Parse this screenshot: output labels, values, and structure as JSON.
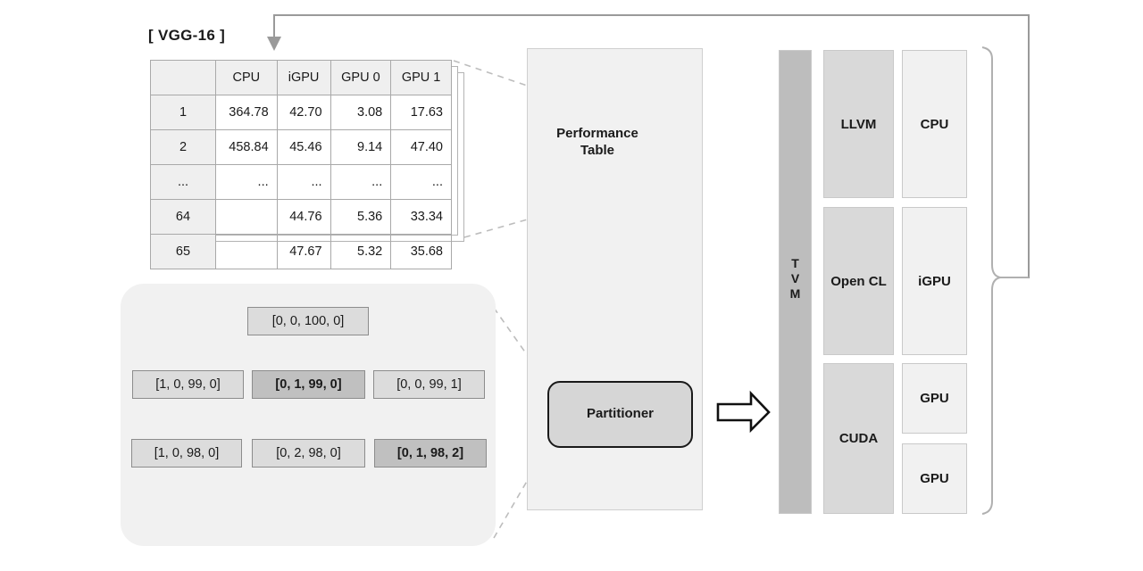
{
  "title": "[ VGG-16 ]",
  "perf_table": {
    "columns": [
      "",
      "CPU",
      "iGPU",
      "GPU 0",
      "GPU 1"
    ],
    "rows": [
      [
        "1",
        "364.78",
        "42.70",
        "3.08",
        "17.63"
      ],
      [
        "2",
        "458.84",
        "45.46",
        "9.14",
        "47.40"
      ],
      [
        "...",
        "...",
        "...",
        "...",
        "..."
      ],
      [
        "64",
        "",
        "44.76",
        "5.36",
        "33.34"
      ],
      [
        "65",
        "",
        "47.67",
        "5.32",
        "35.68"
      ]
    ]
  },
  "tree": {
    "root": {
      "label": "[0, 0, 100, 0]",
      "highlight": false
    },
    "level1": [
      {
        "label": "[1, 0, 99, 0]",
        "highlight": false
      },
      {
        "label": "[0, 1, 99, 0]",
        "highlight": true
      },
      {
        "label": "[0, 0, 99, 1]",
        "highlight": false
      }
    ],
    "level2": [
      {
        "label": "[1, 0, 98, 0]",
        "highlight": false
      },
      {
        "label": "[0, 2, 98, 0]",
        "highlight": false
      },
      {
        "label": "[0, 1, 98, 2]",
        "highlight": true
      }
    ]
  },
  "center": {
    "performance_table_label": "Performance\nTable",
    "performance_table_line1": "Performance",
    "performance_table_line2": "Table",
    "partitioner_label": "Partitioner"
  },
  "runtime": {
    "tvm_label": "T V M",
    "backends": [
      {
        "label": "LLVM"
      },
      {
        "label": "Open CL"
      },
      {
        "label": "CUDA"
      }
    ],
    "devices": [
      {
        "label": "CPU"
      },
      {
        "label": "iGPU"
      },
      {
        "label": "GPU"
      },
      {
        "label": "GPU"
      }
    ]
  },
  "colors": {
    "panel_gray": "#f1f1f1",
    "node_gray": "#dcdcdc",
    "node_highlight": "#c0c0c0",
    "tvm_gray": "#bdbdbd",
    "backend_gray": "#d9d9d9",
    "device_gray": "#f1f1f1",
    "arrow_gray": "#9a9a9a",
    "arrow_black": "#111111"
  }
}
